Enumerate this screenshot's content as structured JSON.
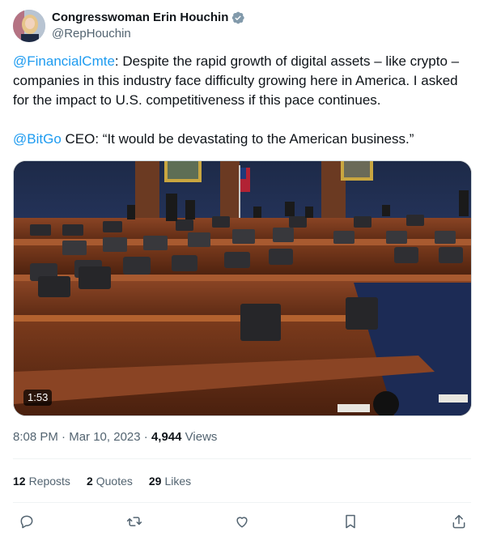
{
  "author": {
    "display_name": "Congresswoman Erin Houchin",
    "handle": "@RepHouchin",
    "verified_icon": "verified-badge-icon"
  },
  "post": {
    "mention_1": "@FinancialCmte",
    "text_1": ": Despite the rapid growth of digital assets – like crypto – companies in this industry face difficulty growing here in America. I asked for the impact to U.S. competitiveness if this pace continues.",
    "mention_2": "@BitGo",
    "text_2": " CEO: “It would be devastating to the American business.”"
  },
  "media": {
    "duration": "1:53"
  },
  "meta": {
    "time": "8:08 PM",
    "sep1": " · ",
    "date": "Mar 10, 2023",
    "sep2": " · ",
    "views_count": "4,944",
    "views_label": " Views"
  },
  "stats": {
    "reposts_count": "12",
    "reposts_label": "Reposts",
    "quotes_count": "2",
    "quotes_label": "Quotes",
    "likes_count": "29",
    "likes_label": "Likes"
  },
  "actions": [
    "reply-icon",
    "repost-icon",
    "like-icon",
    "bookmark-icon",
    "share-icon"
  ],
  "colors": {
    "link": "#1d9bf0",
    "muted": "#536471",
    "text": "#0f1419"
  }
}
